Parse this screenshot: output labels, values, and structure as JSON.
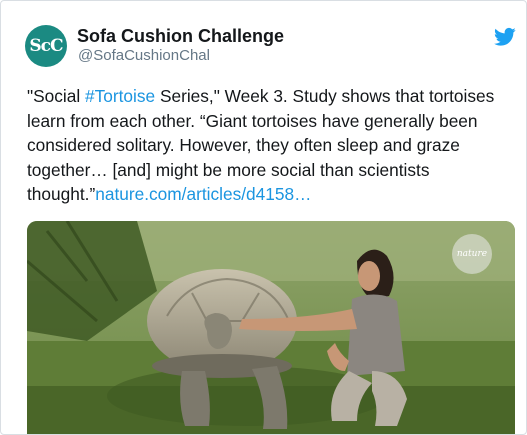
{
  "tweet": {
    "display_name": "Sofa Cushion Challenge",
    "handle": "@SofaCushionChal",
    "avatar_text": "ScC",
    "text_before": "\"Social ",
    "hashtag": "#Tortoise",
    "text_middle": " Series,\" Week 3. Study shows that tortoises learn from each other. “Giant tortoises have generally been considered solitary. However, they often sleep and graze together… [and] might be more social than scientists thought.”",
    "link": "nature.com/articles/d4158…"
  },
  "media": {
    "watermark": "nature",
    "description_icon": "photo"
  },
  "colors": {
    "link": "#1b95e0",
    "avatar_bg": "#1b8a82",
    "twitter_blue": "#1da1f2"
  },
  "icons": {
    "brand": "twitter-bird-icon"
  }
}
